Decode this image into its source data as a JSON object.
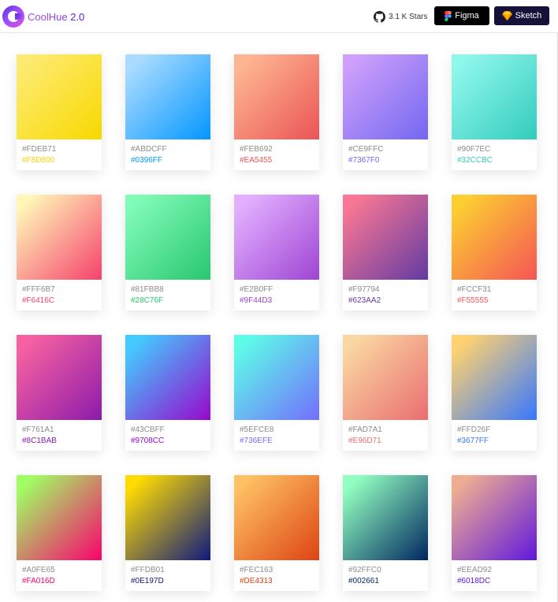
{
  "app": {
    "name": "CoolHue",
    "version": "2.0"
  },
  "header": {
    "stars_label": "3.1 K Stars",
    "figma_label": "Figma",
    "sketch_label": "Sketch"
  },
  "gradients": [
    {
      "from": "#FDEB71",
      "to": "#F8D800"
    },
    {
      "from": "#ABDCFF",
      "to": "#0396FF"
    },
    {
      "from": "#FEB692",
      "to": "#EA5455"
    },
    {
      "from": "#CE9FFC",
      "to": "#7367F0"
    },
    {
      "from": "#90F7EC",
      "to": "#32CCBC"
    },
    {
      "from": "#FFF6B7",
      "to": "#F6416C"
    },
    {
      "from": "#81FBB8",
      "to": "#28C76F"
    },
    {
      "from": "#E2B0FF",
      "to": "#9F44D3"
    },
    {
      "from": "#F97794",
      "to": "#623AA2"
    },
    {
      "from": "#FCCF31",
      "to": "#F55555"
    },
    {
      "from": "#F761A1",
      "to": "#8C1BAB"
    },
    {
      "from": "#43CBFF",
      "to": "#9708CC"
    },
    {
      "from": "#5EFCE8",
      "to": "#736EFE"
    },
    {
      "from": "#FAD7A1",
      "to": "#E96D71"
    },
    {
      "from": "#FFD26F",
      "to": "#3677FF"
    },
    {
      "from": "#A0FE65",
      "to": "#FA016D"
    },
    {
      "from": "#FFDB01",
      "to": "#0E197D"
    },
    {
      "from": "#FEC163",
      "to": "#DE4313"
    },
    {
      "from": "#92FFC0",
      "to": "#002661"
    },
    {
      "from": "#EEAD92",
      "to": "#6018DC"
    }
  ]
}
